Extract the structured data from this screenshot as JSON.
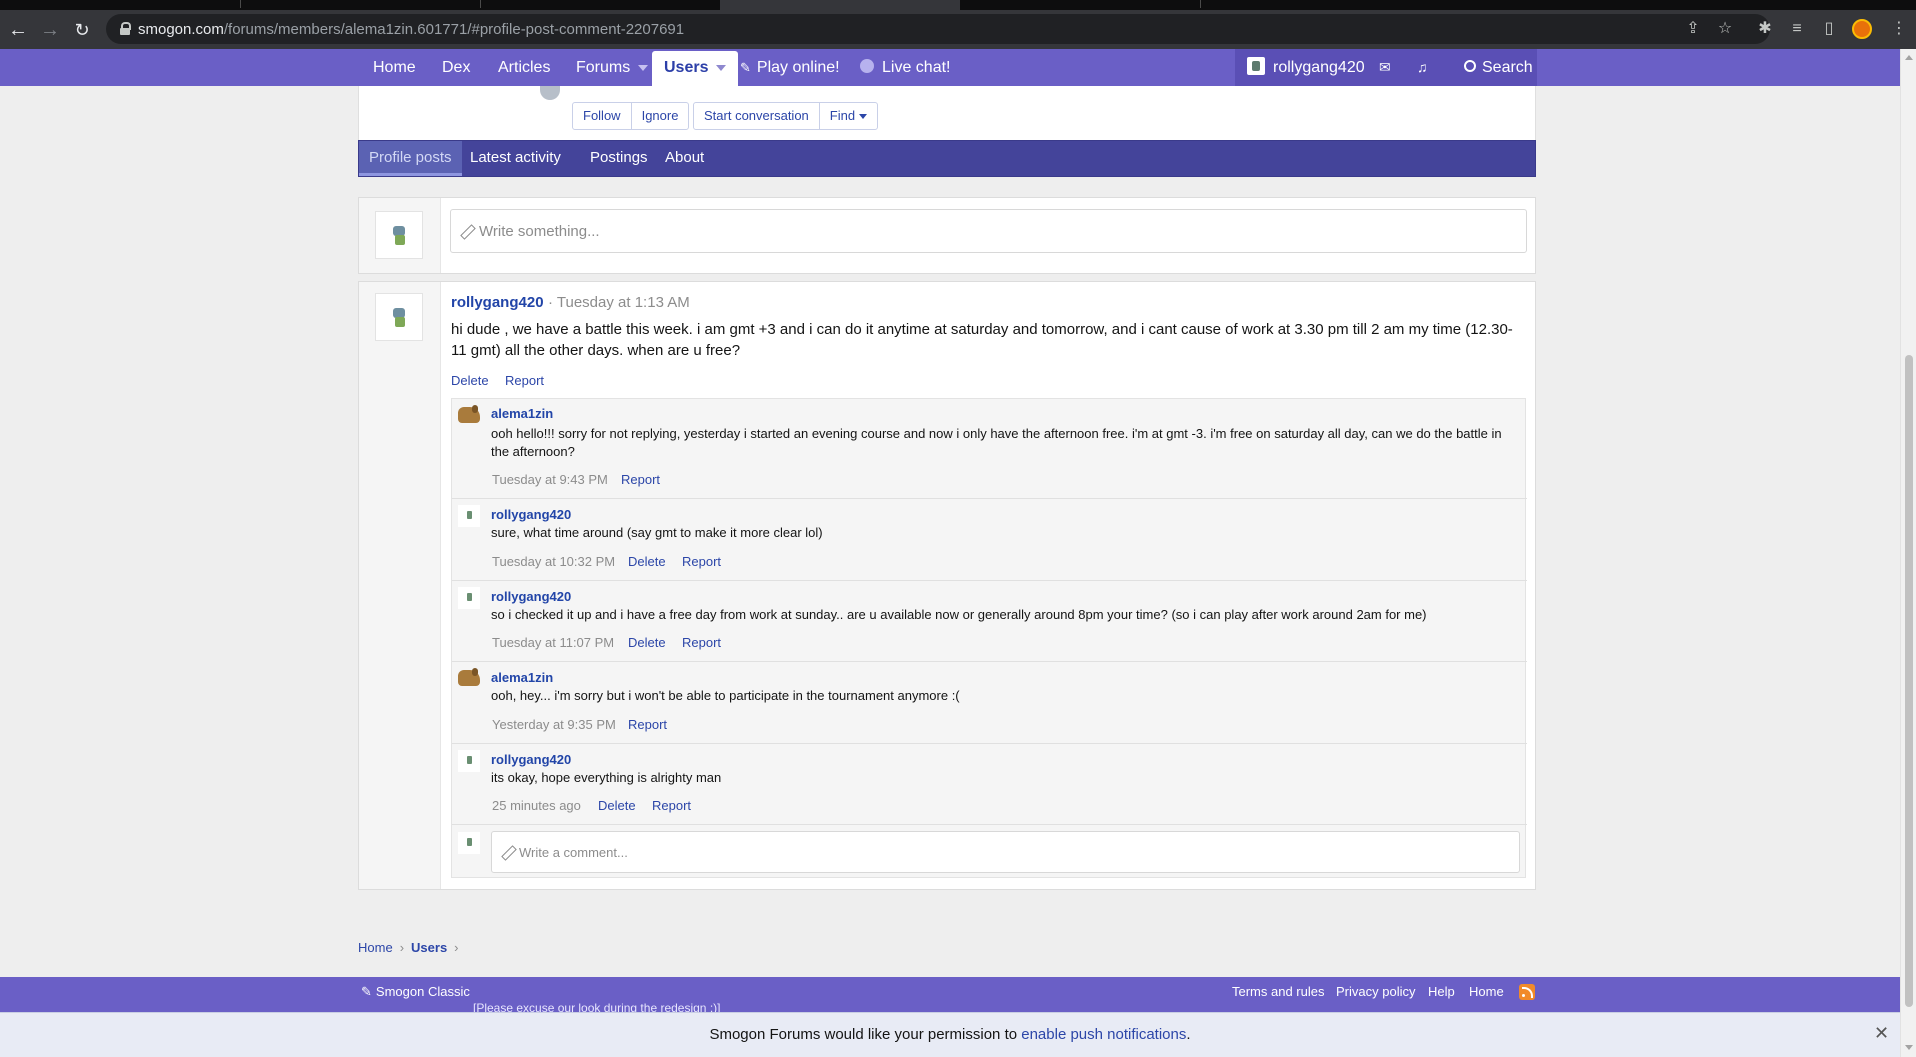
{
  "browser": {
    "url_domain": "smogon.com",
    "url_path": "/forums/members/alema1zin.601771/#profile-post-comment-2207691"
  },
  "nav": {
    "home": "Home",
    "dex": "Dex",
    "articles": "Articles",
    "forums": "Forums",
    "users": "Users",
    "play_online": "Play online!",
    "live_chat": "Live chat!",
    "username": "rollygang420",
    "search": "Search"
  },
  "profile_actions": {
    "follow": "Follow",
    "ignore": "Ignore",
    "start_conversation": "Start conversation",
    "find": "Find"
  },
  "profile_tabs": {
    "profile_posts": "Profile posts",
    "latest_activity": "Latest activity",
    "postings": "Postings",
    "about": "About"
  },
  "new_post": {
    "placeholder": "Write something..."
  },
  "post": {
    "author": "rollygang420",
    "time": "· Tuesday at 1:13 AM",
    "body_line1": "hi dude , we have a battle this week. i am gmt +3 and i can do it anytime at saturday and tomorrow, and i cant cause of work at 3.30 pm till 2 am my time (12.30-",
    "body_line2": "11 gmt) all the other days. when are u free?",
    "delete": "Delete",
    "report": "Report"
  },
  "comments": [
    {
      "author": "alema1zin",
      "body": "ooh hello!!! sorry for not replying, yesterday i started an evening course and now i only have the afternoon free. i'm at gmt -3. i'm free on saturday all day, can we do the battle in the afternoon?",
      "time": "Tuesday at 9:43 PM",
      "report": "Report"
    },
    {
      "author": "rollygang420",
      "body": "sure, what time around (say gmt to make it more clear lol)",
      "time": "Tuesday at 10:32 PM",
      "delete": "Delete",
      "report": "Report"
    },
    {
      "author": "rollygang420",
      "body": "so i checked it up and i have a free day from work at sunday.. are u available now or generally around 8pm your time? (so i can play after work around 2am for me)",
      "time": "Tuesday at 11:07 PM",
      "delete": "Delete",
      "report": "Report"
    },
    {
      "author": "alema1zin",
      "body": "ooh, hey... i'm sorry but i won't be able to participate in the tournament anymore :(",
      "time": "Yesterday at 9:35 PM",
      "report": "Report"
    },
    {
      "author": "rollygang420",
      "body": "its okay, hope everything is alrighty man",
      "time": "25 minutes ago",
      "delete": "Delete",
      "report": "Report"
    }
  ],
  "comment_input": {
    "placeholder": "Write a comment..."
  },
  "breadcrumb": {
    "home": "Home",
    "users": "Users"
  },
  "footer": {
    "style": "Smogon Classic",
    "note": "[Please excuse our look during the redesign :)]",
    "terms": "Terms and rules",
    "privacy": "Privacy policy",
    "help": "Help",
    "home": "Home"
  },
  "push": {
    "text": "Smogon Forums would like your permission to",
    "link": "enable push notifications",
    "end": "."
  }
}
